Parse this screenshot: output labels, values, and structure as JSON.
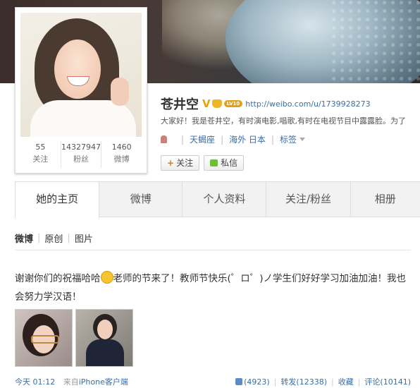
{
  "profile": {
    "name": "苍井空",
    "verified_mark": "V",
    "level_badge": "LV10",
    "url": "http://weibo.com/u/1739928273",
    "intro": "大家好！我是苍井空，有时演电影,唱歌,有时在电视节目中露露脸。为了",
    "zodiac": "天蝎座",
    "location": "海外 日本",
    "tags_label": "标签"
  },
  "stats": [
    {
      "value": "55",
      "label": "关注"
    },
    {
      "value": "14327947",
      "label": "粉丝"
    },
    {
      "value": "1460",
      "label": "微博"
    }
  ],
  "buttons": {
    "follow": "关注",
    "message": "私信"
  },
  "tabs": [
    "她的主页",
    "微博",
    "个人资料",
    "关注/粉丝",
    "相册"
  ],
  "subnav": [
    "微博",
    "原创",
    "图片"
  ],
  "post": {
    "text_part1": "谢谢你们的祝福哈哈",
    "text_part2": "老师的节来了！教师节快乐(゜ロ゜)ノ学生们好好学习加油加油！我也会努力学汉语！",
    "time": "今天 01:12",
    "source_prefix": "来自",
    "source": "iPhone客户端",
    "likes": "(4923)",
    "repost": "转发(12338)",
    "favorite": "收藏",
    "comment": "评论(10141)"
  },
  "colors": {
    "link": "#3a6ea5",
    "verified": "#e8a400",
    "follow_plus": "#e07d16"
  }
}
